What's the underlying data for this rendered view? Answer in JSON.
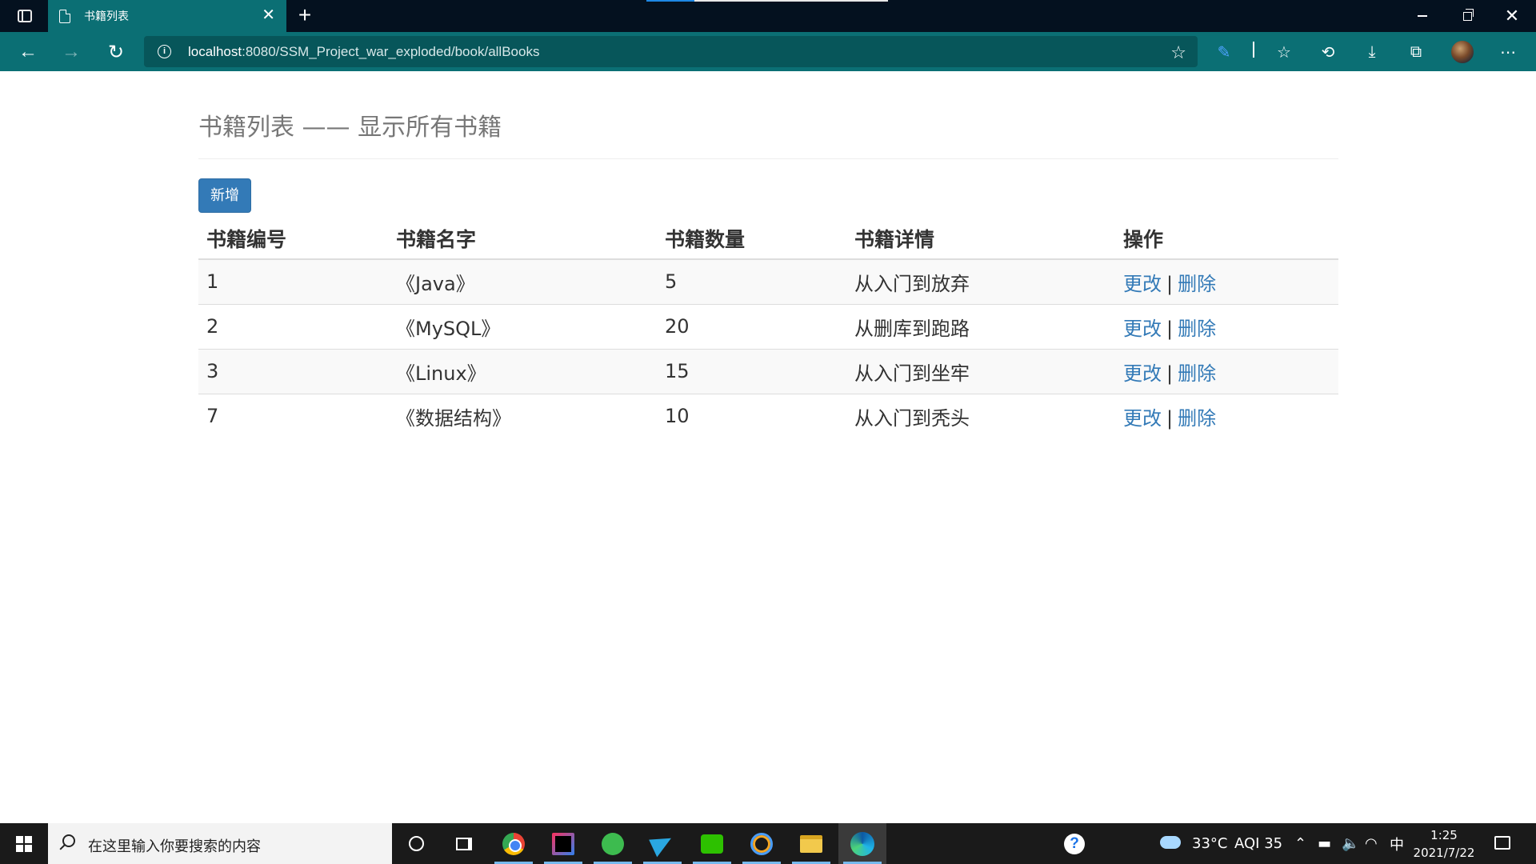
{
  "browser": {
    "tab_title": "书籍列表",
    "url_host": "localhost",
    "url_rest": ":8080/SSM_Project_war_exploded/book/allBooks",
    "icons": {
      "tab_actions": "tab-actions-icon",
      "new_tab": "plus-icon",
      "back": "back-arrow-icon",
      "forward": "forward-arrow-icon",
      "refresh": "refresh-icon",
      "site_info": "info-icon",
      "add_favorite": "star-plus-icon",
      "pen": "pen-icon",
      "favorites": "favorites-icon",
      "history": "history-icon",
      "downloads": "download-icon",
      "collections": "collections-icon",
      "profile": "avatar",
      "more": "more-icon"
    }
  },
  "page": {
    "header": "书籍列表 —— 显示所有书籍",
    "add_button": "新增",
    "columns": [
      "书籍编号",
      "书籍名字",
      "书籍数量",
      "书籍详情",
      "操作"
    ],
    "rows": [
      {
        "id": "1",
        "name": "《Java》",
        "count": "5",
        "detail": "从入门到放弃"
      },
      {
        "id": "2",
        "name": "《MySQL》",
        "count": "20",
        "detail": "从删库到跑路"
      },
      {
        "id": "3",
        "name": "《Linux》",
        "count": "15",
        "detail": "从入门到坐牢"
      },
      {
        "id": "7",
        "name": "《数据结构》",
        "count": "10",
        "detail": "从入门到秃头"
      }
    ],
    "edit_label": "更改",
    "separator": "|",
    "delete_label": "删除",
    "link_color": "#337ab7"
  },
  "taskbar": {
    "search_placeholder": "在这里输入你要搜索的内容",
    "weather": "33°C",
    "aqi": "AQI 35",
    "ime": "中",
    "time": "1:25",
    "date": "2021/7/22"
  },
  "colors": {
    "browser_accent": "#0b6f74",
    "titlebar": "#04111f",
    "primary_button": "#337ab7"
  }
}
